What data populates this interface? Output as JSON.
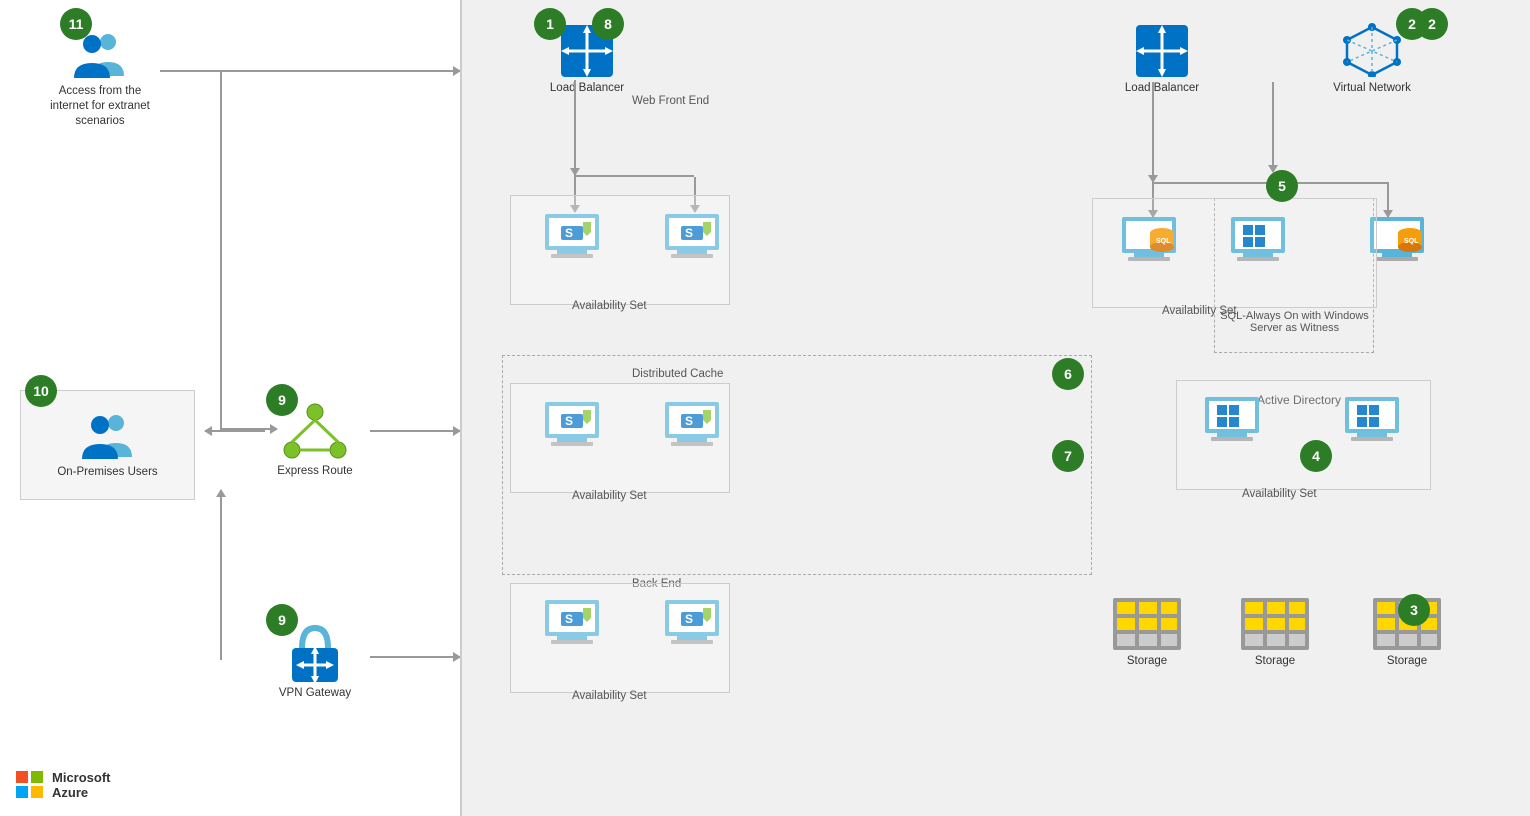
{
  "badges": {
    "b1": "1",
    "b2": "2",
    "b3": "3",
    "b4": "4",
    "b5": "5",
    "b6": "6",
    "b7": "7",
    "b8": "8",
    "b9a": "9",
    "b9b": "9",
    "b10": "10",
    "b11": "11"
  },
  "labels": {
    "loadBalancer1": "Load Balancer",
    "loadBalancer2": "Load Balancer",
    "virtualNetwork": "Virtual Network",
    "webFrontEnd": "Web Front End",
    "availabilitySet": "Availability Set",
    "distributedCache": "Distributed Cache",
    "backEnd": "Back End",
    "sqlAlwaysOn": "SQL-Always On\nwith Windows Server\nas Witness",
    "activeDirectory": "Active Directory",
    "storage1": "Storage",
    "storage2": "Storage",
    "storage3": "Storage",
    "expressRoute": "Express Route",
    "vpnGateway": "VPN Gateway",
    "onPremisesUsers": "On-Premises Users",
    "accessInternet": "Access from the\ninternet for extranet\nscenarios",
    "msAzure": "Microsoft\nAzure"
  },
  "colors": {
    "green": "#2d7d27",
    "blue": "#0072c6",
    "lightBlue": "#59b4d9",
    "gray": "#f0f0f0",
    "darkGray": "#666"
  }
}
